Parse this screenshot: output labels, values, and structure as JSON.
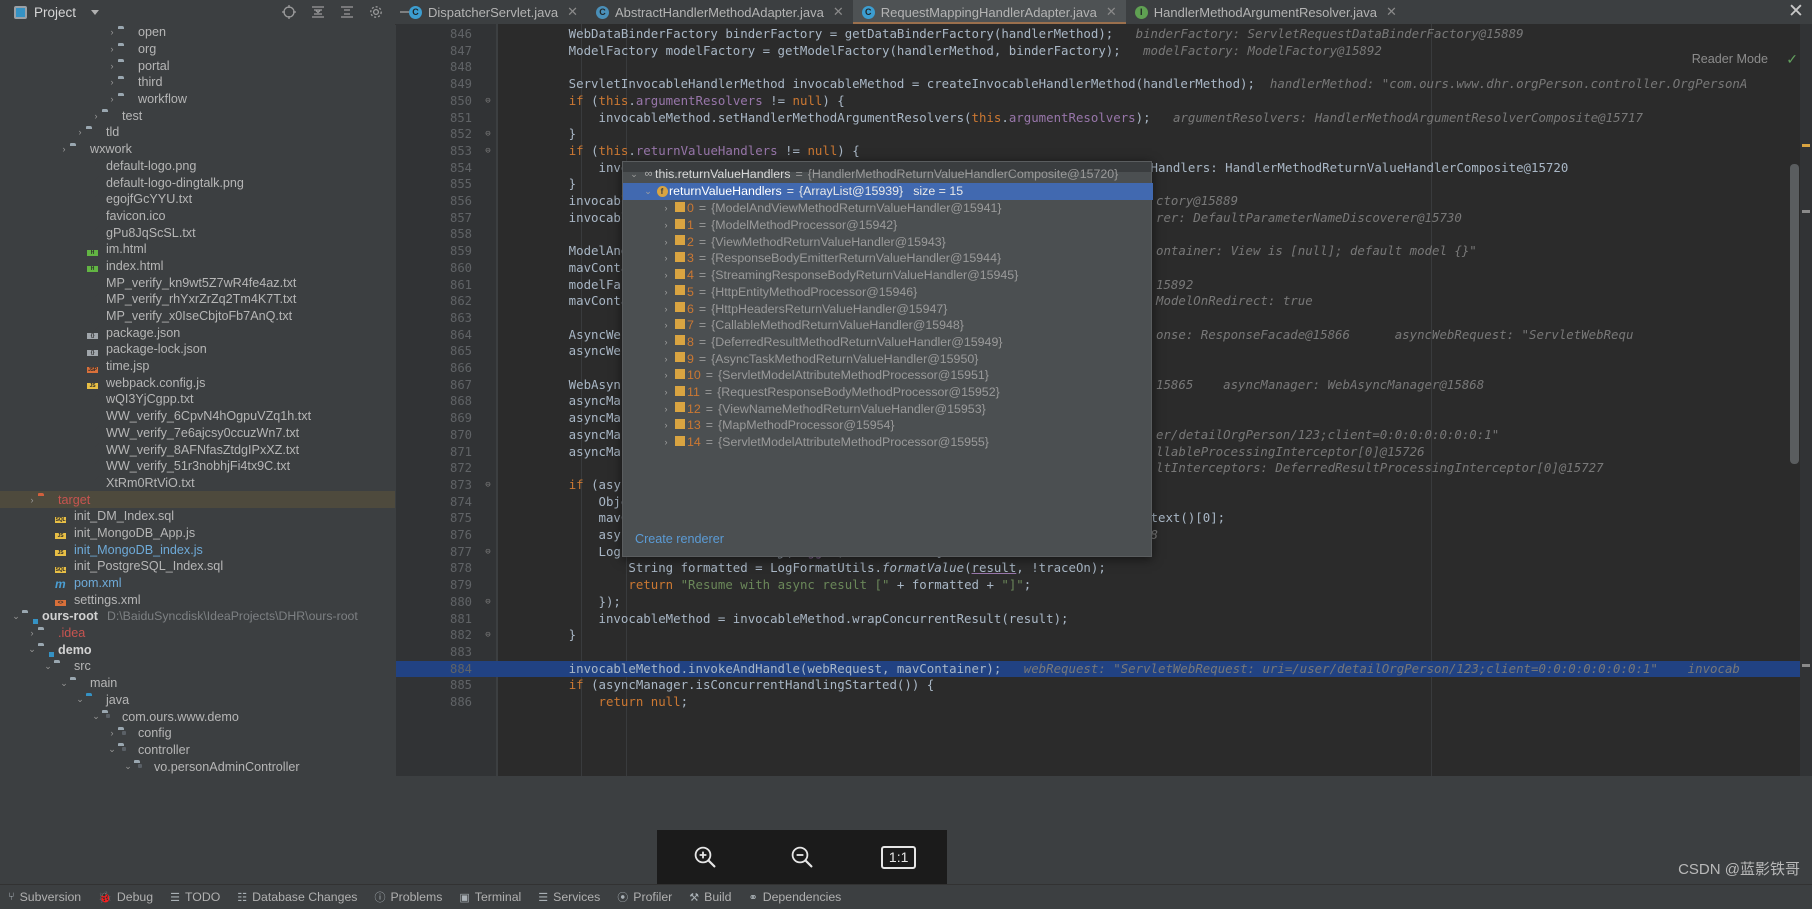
{
  "window": {
    "project_button": "Project",
    "close_label": "✕",
    "reader_mode": "Reader Mode"
  },
  "toolbar_icons": [
    "locate-icon",
    "collapse-all-icon",
    "expand-all-icon",
    "settings-icon",
    "minimize-icon"
  ],
  "tabs": [
    {
      "label": "DispatcherServlet.java",
      "icon": "class-icon",
      "icon_letter": "C",
      "active": false
    },
    {
      "label": "AbstractHandlerMethodAdapter.java",
      "icon": "abstract-class-icon",
      "icon_letter": "C",
      "active": false
    },
    {
      "label": "RequestMappingHandlerAdapter.java",
      "icon": "class-icon",
      "icon_letter": "C",
      "active": true
    },
    {
      "label": "HandlerMethodArgumentResolver.java",
      "icon": "interface-icon",
      "icon_letter": "I",
      "active": false
    }
  ],
  "tree": [
    {
      "indent": 6,
      "arrow": "›",
      "icon": "folder",
      "label": "open",
      "kind": "folder"
    },
    {
      "indent": 6,
      "arrow": "›",
      "icon": "folder",
      "label": "org",
      "kind": "folder"
    },
    {
      "indent": 6,
      "arrow": "›",
      "icon": "folder",
      "label": "portal",
      "kind": "folder"
    },
    {
      "indent": 6,
      "arrow": "›",
      "icon": "folder",
      "label": "third",
      "kind": "folder"
    },
    {
      "indent": 6,
      "arrow": "›",
      "icon": "folder",
      "label": "workflow",
      "kind": "folder"
    },
    {
      "indent": 5,
      "arrow": "›",
      "icon": "folder",
      "label": "test",
      "kind": "folder"
    },
    {
      "indent": 4,
      "arrow": "›",
      "icon": "folder",
      "label": "tld",
      "kind": "folder"
    },
    {
      "indent": 3,
      "arrow": "›",
      "icon": "folder",
      "label": "wxwork",
      "kind": "folder"
    },
    {
      "indent": 4,
      "arrow": "",
      "icon": "image-file",
      "label": "default-logo.png",
      "kind": "file",
      "badge": "",
      "badge_class": "b-img"
    },
    {
      "indent": 4,
      "arrow": "",
      "icon": "image-file",
      "label": "default-logo-dingtalk.png",
      "kind": "file",
      "badge": "",
      "badge_class": "b-img"
    },
    {
      "indent": 4,
      "arrow": "",
      "icon": "text-file",
      "label": "egojfGcYYU.txt",
      "kind": "file"
    },
    {
      "indent": 4,
      "arrow": "",
      "icon": "image-file",
      "label": "favicon.ico",
      "kind": "file",
      "badge": "",
      "badge_class": "b-img"
    },
    {
      "indent": 4,
      "arrow": "",
      "icon": "text-file",
      "label": "gPu8JqScSL.txt",
      "kind": "file"
    },
    {
      "indent": 4,
      "arrow": "",
      "icon": "html-file",
      "label": "im.html",
      "kind": "file",
      "badge": "H",
      "badge_class": "b-html"
    },
    {
      "indent": 4,
      "arrow": "",
      "icon": "html-file",
      "label": "index.html",
      "kind": "file",
      "badge": "H",
      "badge_class": "b-html"
    },
    {
      "indent": 4,
      "arrow": "",
      "icon": "text-file",
      "label": "MP_verify_kn9wt5Z7wR4fe4az.txt",
      "kind": "file"
    },
    {
      "indent": 4,
      "arrow": "",
      "icon": "text-file",
      "label": "MP_verify_rhYxrZrZq2Tm4K7T.txt",
      "kind": "file"
    },
    {
      "indent": 4,
      "arrow": "",
      "icon": "text-file",
      "label": "MP_verify_x0IseCbjtoFb7AnQ.txt",
      "kind": "file"
    },
    {
      "indent": 4,
      "arrow": "",
      "icon": "json-file",
      "label": "package.json",
      "kind": "file",
      "badge": "{}",
      "badge_class": "b-json"
    },
    {
      "indent": 4,
      "arrow": "",
      "icon": "json-file",
      "label": "package-lock.json",
      "kind": "file",
      "badge": "{}",
      "badge_class": "b-json"
    },
    {
      "indent": 4,
      "arrow": "",
      "icon": "jsp-file",
      "label": "time.jsp",
      "kind": "file",
      "badge": "JSP",
      "badge_class": "b-jsp"
    },
    {
      "indent": 4,
      "arrow": "",
      "icon": "js-file",
      "label": "webpack.config.js",
      "kind": "file",
      "badge": "JS",
      "badge_class": "b-js"
    },
    {
      "indent": 4,
      "arrow": "",
      "icon": "text-file",
      "label": "wQI3YjCgpp.txt",
      "kind": "file"
    },
    {
      "indent": 4,
      "arrow": "",
      "icon": "text-file",
      "label": "WW_verify_6CpvN4hOgpuVZq1h.txt",
      "kind": "file"
    },
    {
      "indent": 4,
      "arrow": "",
      "icon": "text-file",
      "label": "WW_verify_7e6ajcsy0ccuzWn7.txt",
      "kind": "file"
    },
    {
      "indent": 4,
      "arrow": "",
      "icon": "text-file",
      "label": "WW_verify_8AFNfasZtdgIPxXZ.txt",
      "kind": "file"
    },
    {
      "indent": 4,
      "arrow": "",
      "icon": "text-file",
      "label": "WW_verify_51r3nobhjFi4tx9C.txt",
      "kind": "file"
    },
    {
      "indent": 4,
      "arrow": "",
      "icon": "text-file",
      "label": "XtRm0RtViO.txt",
      "kind": "file"
    },
    {
      "indent": 1,
      "arrow": "›",
      "icon": "folder-red",
      "label": "target",
      "kind": "folder",
      "label_class": "red",
      "selected": true
    },
    {
      "indent": 2,
      "arrow": "",
      "icon": "sql-file",
      "label": "init_DM_Index.sql",
      "kind": "file",
      "badge": "SQL",
      "badge_class": "b-sql"
    },
    {
      "indent": 2,
      "arrow": "",
      "icon": "js-file",
      "label": "init_MongoDB_App.js",
      "kind": "file",
      "badge": "JS",
      "badge_class": "b-js"
    },
    {
      "indent": 2,
      "arrow": "",
      "icon": "js-file",
      "label": "init_MongoDB_index.js",
      "kind": "file",
      "badge": "JS",
      "badge_class": "b-js",
      "label_class": "blue"
    },
    {
      "indent": 2,
      "arrow": "",
      "icon": "sql-file",
      "label": "init_PostgreSQL_Index.sql",
      "kind": "file",
      "badge": "SQL",
      "badge_class": "b-sql"
    },
    {
      "indent": 2,
      "arrow": "",
      "icon": "maven-file",
      "label": "pom.xml",
      "kind": "maven",
      "label_class": "blue"
    },
    {
      "indent": 2,
      "arrow": "",
      "icon": "xml-file",
      "label": "settings.xml",
      "kind": "file",
      "badge": "<>",
      "badge_class": "b-xml"
    },
    {
      "indent": 0,
      "arrow": "⌄",
      "icon": "module-folder",
      "label": "ours-root",
      "kind": "module",
      "label_class": "bold",
      "path": "D:\\BaiduSyncdisk\\IdeaProjects\\DHR\\ours-root"
    },
    {
      "indent": 1,
      "arrow": "›",
      "icon": "folder",
      "label": ".idea",
      "kind": "folder",
      "label_class": "red"
    },
    {
      "indent": 1,
      "arrow": "⌄",
      "icon": "module-folder",
      "label": "demo",
      "kind": "module",
      "label_class": "bold"
    },
    {
      "indent": 2,
      "arrow": "⌄",
      "icon": "folder",
      "label": "src",
      "kind": "folder"
    },
    {
      "indent": 3,
      "arrow": "⌄",
      "icon": "folder",
      "label": "main",
      "kind": "folder"
    },
    {
      "indent": 4,
      "arrow": "⌄",
      "icon": "source-folder",
      "label": "java",
      "kind": "srcfolder"
    },
    {
      "indent": 5,
      "arrow": "⌄",
      "icon": "package",
      "label": "com.ours.www.demo",
      "kind": "package"
    },
    {
      "indent": 6,
      "arrow": "›",
      "icon": "package",
      "label": "config",
      "kind": "package"
    },
    {
      "indent": 6,
      "arrow": "⌄",
      "icon": "package",
      "label": "controller",
      "kind": "package"
    },
    {
      "indent": 7,
      "arrow": "⌄",
      "icon": "package",
      "label": "vo.personAdminController",
      "kind": "package"
    }
  ],
  "code": {
    "first_line_number": 846,
    "lines": [
      {
        "n": 846,
        "fold": "",
        "html": "        WebDataBinderFactory binderFactory = getDataBinderFactory(handlerMethod);<span class=\"hint\">   binderFactory: ServletRequestDataBinderFactory@15889</span>"
      },
      {
        "n": 847,
        "fold": "",
        "html": "        ModelFactory modelFactory = getModelFactory(handlerMethod, binderFactory);<span class=\"hint\">   modelFactory: ModelFactory@15892</span>"
      },
      {
        "n": 848,
        "fold": "",
        "html": ""
      },
      {
        "n": 849,
        "fold": "",
        "html": "        ServletInvocableHandlerMethod invocableMethod = createInvocableHandlerMethod(handlerMethod);<span class=\"hint\">  handlerMethod: \"com.ours.www.dhr.orgPerson.controller.OrgPersonA</span>"
      },
      {
        "n": 850,
        "fold": "⊖",
        "html": "        <span class=\"kw\">if</span> (<span class=\"kw\">this</span>.<span class=\"fld\">argumentResolvers</span> != <span class=\"kw\">null</span>) {"
      },
      {
        "n": 851,
        "fold": "",
        "html": "            invocableMethod.setHandlerMethodArgumentResolvers(<span class=\"kw\">this</span>.<span class=\"fld\">argumentResolvers</span>);<span class=\"hint\">   argumentResolvers: HandlerMethodArgumentResolverComposite@15717</span>"
      },
      {
        "n": 852,
        "fold": "⊖",
        "html": "        }"
      },
      {
        "n": 853,
        "fold": "⊖",
        "html": "        <span class=\"kw\">if</span> (<span class=\"kw\">this</span>.<span class=\"fld\">returnValueHandlers</span> != <span class=\"kw\">null</span>) {"
      },
      {
        "n": 854,
        "fold": "",
        "html": "            invocableMet                                                              Handlers: HandlerMethodReturnValueHandlerComposite@15720"
      },
      {
        "n": 855,
        "fold": "",
        "html": "        }"
      },
      {
        "n": 856,
        "fold": "",
        "html": "        invocableMethod."
      },
      {
        "n": 857,
        "fold": "",
        "html": "        invocableMethod."
      },
      {
        "n": 858,
        "fold": "",
        "html": ""
      },
      {
        "n": 859,
        "fold": "",
        "html": "        ModelAndViewCont"
      },
      {
        "n": 860,
        "fold": "",
        "html": "        mavContainer.add"
      },
      {
        "n": 861,
        "fold": "",
        "html": "        modelFactory.ini"
      },
      {
        "n": 862,
        "fold": "",
        "html": "        mavContainer.set"
      },
      {
        "n": 863,
        "fold": "",
        "html": ""
      },
      {
        "n": 864,
        "fold": "",
        "html": "        AsyncWebRequest"
      },
      {
        "n": 865,
        "fold": "",
        "html": "        asyncWebRequest."
      },
      {
        "n": 866,
        "fold": "",
        "html": ""
      },
      {
        "n": 867,
        "fold": "",
        "html": "        WebAsyncManager"
      },
      {
        "n": 868,
        "fold": "",
        "html": "        asyncManager.set"
      },
      {
        "n": 869,
        "fold": "",
        "html": "        asyncManager.set"
      },
      {
        "n": 870,
        "fold": "",
        "html": "        asyncManager.reg"
      },
      {
        "n": 871,
        "fold": "",
        "html": "        asyncManager.reg"
      },
      {
        "n": 872,
        "fold": "",
        "html": ""
      },
      {
        "n": 873,
        "fold": "⊖",
        "html": "        <span class=\"kw\">if</span> (asyncManager"
      },
      {
        "n": 874,
        "fold": "",
        "html": "            Object resul"
      },
      {
        "n": 875,
        "fold": "",
        "html": "            mavContainer = (ModelAndViewContainer) asyncManager.getConcurrentResultContext()[0];"
      },
      {
        "n": 876,
        "fold": "",
        "html": "            asyncManager.clearConcurrentResult();<span class=\"hint\">   asyncManager: WebAsyncManager@15868</span>"
      },
      {
        "n": 877,
        "fold": "⊖",
        "html": "            LogFormatUtils.<span class=\"sfn\">traceDebug</span>(<span class=\"fld\">logger</span>, traceOn -> {"
      },
      {
        "n": 878,
        "fold": "",
        "html": "                String formatted = LogFormatUtils.<span class=\"sfn\">formatValue</span>(<span class=\"under\">result</span>, !traceOn);"
      },
      {
        "n": 879,
        "fold": "",
        "html": "                <span class=\"kw\">return</span> <span class=\"str\">\"Resume with async result [\"</span> + formatted + <span class=\"str\">\"]\"</span>;"
      },
      {
        "n": 880,
        "fold": "⊖",
        "html": "            });"
      },
      {
        "n": 881,
        "fold": "",
        "html": "            invocableMethod = invocableMethod.wrapConcurrentResult(result);"
      },
      {
        "n": 882,
        "fold": "⊖",
        "html": "        }"
      },
      {
        "n": 883,
        "fold": "",
        "html": ""
      },
      {
        "n": 884,
        "fold": "",
        "html": "        invocableMethod.invokeAndHandle(webRequest, mavContainer);<span class=\"hint\">   webRequest: \"ServletWebRequest: uri=/user/detailOrgPerson/123;client=0:0:0:0:0:0:0:1\"    invocab</span>",
        "current": true
      },
      {
        "n": 885,
        "fold": "",
        "html": "        <span class=\"kw\">if</span> (asyncManager.isConcurrentHandlingStarted()) {"
      },
      {
        "n": 886,
        "fold": "",
        "html": "            <span class=\"kw\">return</span> <span class=\"kw\">null</span>;"
      }
    ],
    "right_hints": [
      {
        "line": 856,
        "text": "ctory@15889"
      },
      {
        "line": 857,
        "text": "rer: DefaultParameterNameDiscoverer@15730"
      },
      {
        "line": 859,
        "text": "ontainer: View is [null]; default model {}\""
      },
      {
        "line": 861,
        "text": "15892"
      },
      {
        "line": 862,
        "text": "ModelOnRedirect: true"
      },
      {
        "line": 864,
        "text": "onse: ResponseFacade@15866      asyncWebRequest: \"ServletWebRequ"
      },
      {
        "line": 867,
        "text": "15865    asyncManager: WebAsyncManager@15868"
      },
      {
        "line": 870,
        "text": "er/detailOrgPerson/123;client=0:0:0:0:0:0:0:1\""
      },
      {
        "line": 871,
        "text": "llableProcessingInterceptor[0]@15726"
      },
      {
        "line": 872,
        "text": "ltInterceptors: DeferredResultProcessingInterceptor[0]@15727"
      }
    ]
  },
  "popup": {
    "header": {
      "expand": "⌄",
      "icon": "static-field-icon",
      "name": "this.returnValueHandlers",
      "eq": "=",
      "value": "{HandlerMethodReturnValueHandlerComposite@15720}"
    },
    "selected_row": {
      "expand": "⌄",
      "icon": "field-icon",
      "name": "returnValueHandlers",
      "eq": "=",
      "value": "{ArrayList@15939}",
      "extra": "size = 15"
    },
    "items": [
      {
        "index": "0",
        "value": "{ModelAndViewMethodReturnValueHandler@15941}"
      },
      {
        "index": "1",
        "value": "{ModelMethodProcessor@15942}"
      },
      {
        "index": "2",
        "value": "{ViewMethodReturnValueHandler@15943}"
      },
      {
        "index": "3",
        "value": "{ResponseBodyEmitterReturnValueHandler@15944}"
      },
      {
        "index": "4",
        "value": "{StreamingResponseBodyReturnValueHandler@15945}"
      },
      {
        "index": "5",
        "value": "{HttpEntityMethodProcessor@15946}"
      },
      {
        "index": "6",
        "value": "{HttpHeadersReturnValueHandler@15947}"
      },
      {
        "index": "7",
        "value": "{CallableMethodReturnValueHandler@15948}"
      },
      {
        "index": "8",
        "value": "{DeferredResultMethodReturnValueHandler@15949}"
      },
      {
        "index": "9",
        "value": "{AsyncTaskMethodReturnValueHandler@15950}"
      },
      {
        "index": "10",
        "value": "{ServletModelAttributeMethodProcessor@15951}"
      },
      {
        "index": "11",
        "value": "{RequestResponseBodyMethodProcessor@15952}"
      },
      {
        "index": "12",
        "value": "{ViewNameMethodReturnValueHandler@15953}"
      },
      {
        "index": "13",
        "value": "{MapMethodProcessor@15954}"
      },
      {
        "index": "14",
        "value": "{ServletModelAttributeMethodProcessor@15955}"
      }
    ],
    "create_renderer": "Create renderer"
  },
  "statusbar": [
    {
      "icon": "subversion-icon",
      "label": "Subversion"
    },
    {
      "icon": "debug-icon",
      "label": "Debug"
    },
    {
      "icon": "todo-icon",
      "label": "TODO"
    },
    {
      "icon": "database-icon",
      "label": "Database Changes"
    },
    {
      "icon": "problems-icon",
      "label": "Problems"
    },
    {
      "icon": "terminal-icon",
      "label": "Terminal"
    },
    {
      "icon": "services-icon",
      "label": "Services"
    },
    {
      "icon": "profiler-icon",
      "label": "Profiler"
    },
    {
      "icon": "build-icon",
      "label": "Build"
    },
    {
      "icon": "dependencies-icon",
      "label": "Dependencies"
    }
  ],
  "zoom_toolbar": {
    "zoom_in": "zoom-in-icon",
    "zoom_out": "zoom-out-icon",
    "actual_size": "1:1"
  },
  "watermark": "CSDN @蓝影铁哥",
  "colors": {
    "editor_bg": "#2b2b2b",
    "panel_bg": "#3c3f41",
    "selection_blue": "#4169b0",
    "current_line": "#214283",
    "accent_link": "#5b9bd5",
    "tab_active_underline": "#9b704d"
  }
}
